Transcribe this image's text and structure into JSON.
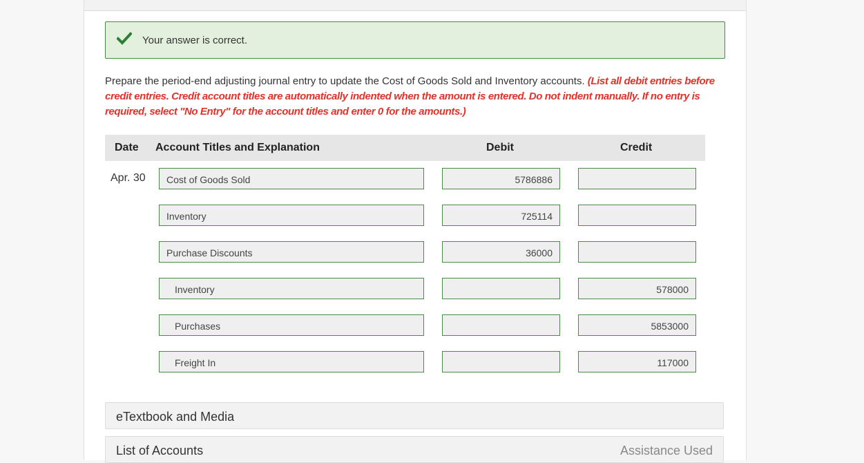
{
  "result": {
    "message": "Your answer is correct."
  },
  "instructions": {
    "text": "Prepare the period-end adjusting journal entry to update the Cost of Goods Sold and Inventory accounts.",
    "note": "(List all debit entries before credit entries. Credit account titles are automatically indented when the amount is entered. Do not indent manually. If no entry is required, select \"No Entry\" for the account titles and enter 0 for the amounts.)"
  },
  "table": {
    "headers": {
      "date": "Date",
      "account": "Account Titles and Explanation",
      "debit": "Debit",
      "credit": "Credit"
    },
    "rows": [
      {
        "date": "Apr. 30",
        "account": "Cost of Goods Sold",
        "debit": "5786886",
        "credit": ""
      },
      {
        "date": "",
        "account": "Inventory",
        "debit": "725114",
        "credit": ""
      },
      {
        "date": "",
        "account": "Purchase Discounts",
        "debit": "36000",
        "credit": ""
      },
      {
        "date": "",
        "account": "Inventory",
        "debit": "",
        "credit": "578000"
      },
      {
        "date": "",
        "account": "Purchases",
        "debit": "",
        "credit": "5853000"
      },
      {
        "date": "",
        "account": "Freight In",
        "debit": "",
        "credit": "117000"
      }
    ]
  },
  "footer": {
    "etextbook": "eTextbook and Media",
    "list_of_accounts": "List of Accounts",
    "assistance": "Assistance Used"
  },
  "colors": {
    "success_bg": "#e3f0de",
    "success_border": "#3f8f3b",
    "check": "#2e7d32",
    "instruction_red": "#e4322b",
    "field_border": "#4b8a45"
  }
}
